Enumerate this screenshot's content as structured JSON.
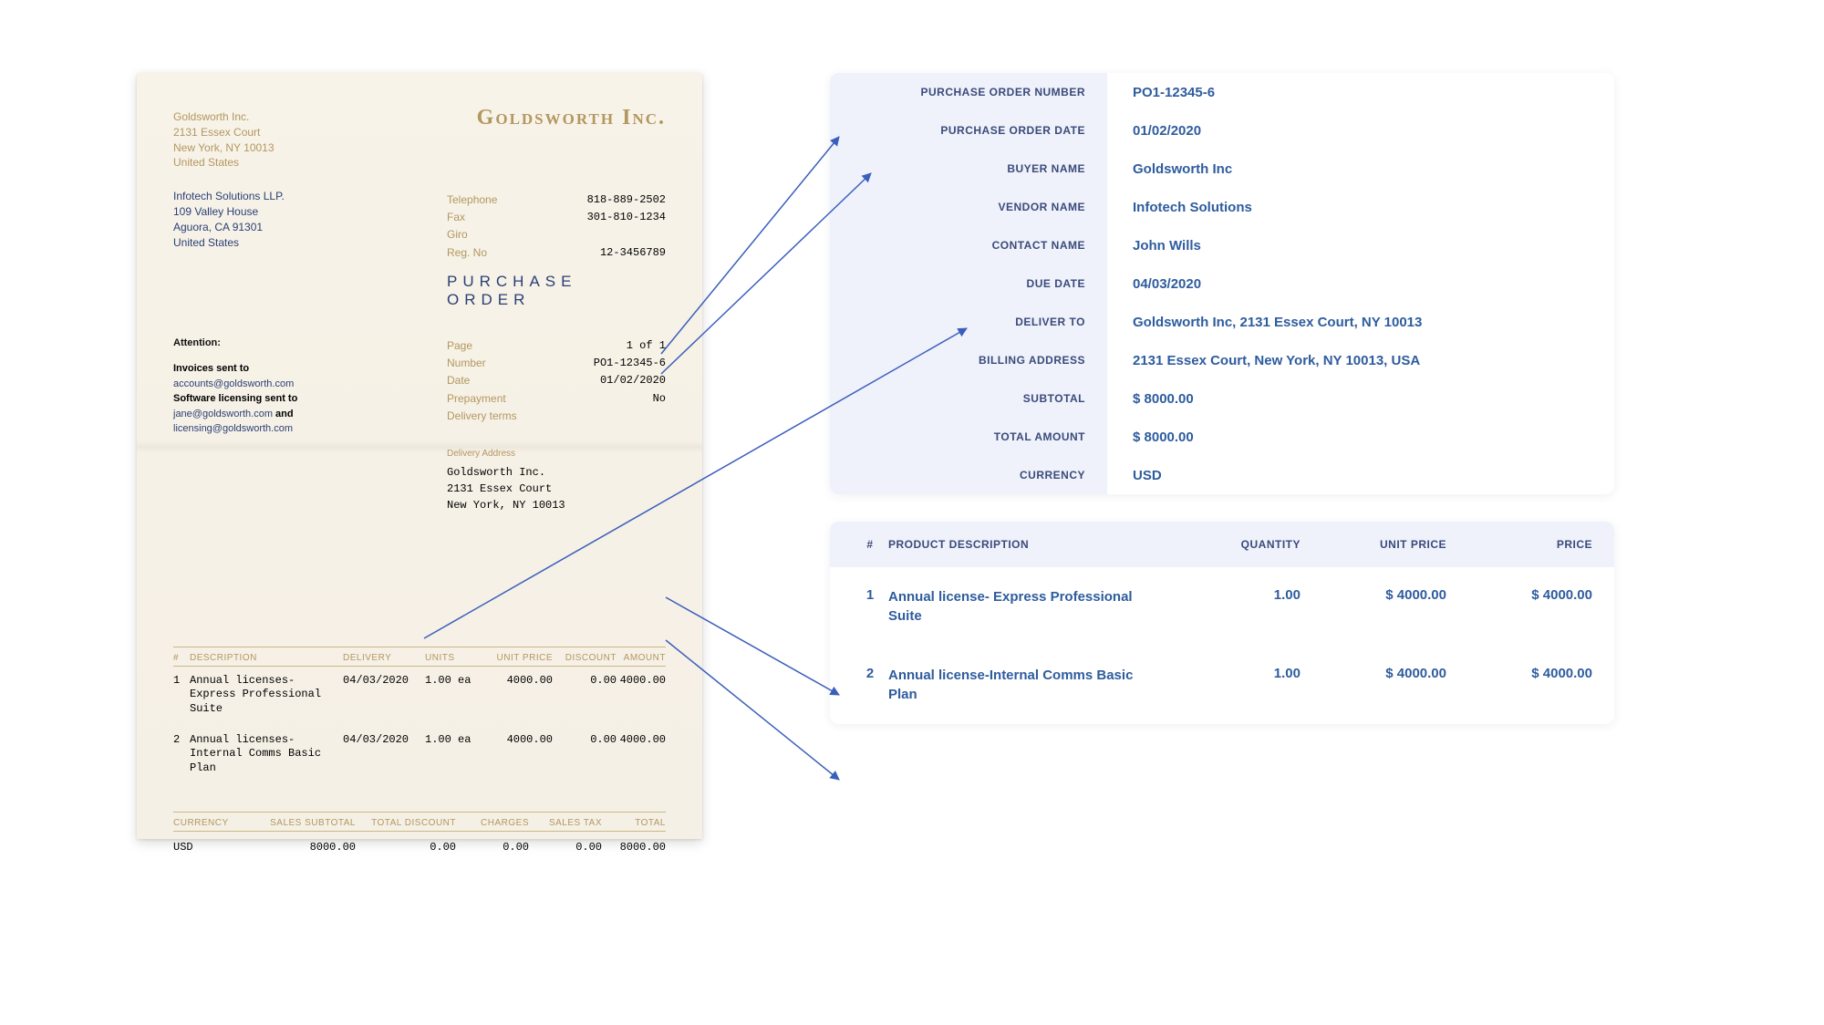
{
  "doc": {
    "brand": "Goldsworth Inc.",
    "from": {
      "name": "Goldsworth Inc.",
      "line1": "2131 Essex Court",
      "line2": "New York, NY 10013",
      "country": "United States"
    },
    "to": {
      "name": "Infotech Solutions LLP.",
      "line1": "109 Valley House",
      "line2": "Aguora, CA 91301",
      "country": "United States"
    },
    "contact": {
      "telephone_k": "Telephone",
      "telephone_v": "818-889-2502",
      "fax_k": "Fax",
      "fax_v": "301-810-1234",
      "giro_k": "Giro",
      "giro_v": "",
      "regno_k": "Reg. No",
      "regno_v": "12-3456789"
    },
    "po_title": "PURCHASE ORDER",
    "meta2": {
      "page_k": "Page",
      "page_v": "1 of 1",
      "number_k": "Number",
      "number_v": "PO1-12345-6",
      "date_k": "Date",
      "date_v": "01/02/2020",
      "prepay_k": "Prepayment",
      "prepay_v": "No",
      "terms_k": "Delivery terms",
      "terms_v": ""
    },
    "attention_hdr": "Attention:",
    "attn": {
      "l1a": "Invoices sent to ",
      "l1b": "accounts@goldsworth.com",
      "l2": "Software licensing sent to",
      "l3a": "jane@goldsworth.com",
      "l3b": " and",
      "l4": "licensing@goldsworth.com"
    },
    "delivery": {
      "hdr": "Delivery Address",
      "l1": "Goldsworth Inc.",
      "l2": "2131 Essex Court",
      "l3": "New York, NY 10013"
    },
    "items_hdr": {
      "num": "#",
      "desc": "DESCRIPTION",
      "deliv": "DELIVERY",
      "units": "UNITS",
      "up": "UNIT PRICE",
      "disc": "DISCOUNT",
      "amt": "AMOUNT"
    },
    "items": [
      {
        "num": "1",
        "desc": "Annual licenses- Express Professional Suite",
        "deliv": "04/03/2020",
        "units": "1.00 ea",
        "up": "4000.00",
        "disc": "0.00",
        "amt": "4000.00"
      },
      {
        "num": "2",
        "desc": "Annual licenses- Internal Comms Basic Plan",
        "deliv": "04/03/2020",
        "units": "1.00 ea",
        "up": "4000.00",
        "disc": "0.00",
        "amt": "4000.00"
      }
    ],
    "totals_hdr": {
      "cur": "CURRENCY",
      "sub": "SALES SUBTOTAL",
      "disc": "TOTAL DISCOUNT",
      "chg": "CHARGES",
      "tax": "SALES TAX",
      "tot": "TOTAL"
    },
    "totals": {
      "cur": "USD",
      "sub": "8000.00",
      "disc": "0.00",
      "chg": "0.00",
      "tax": "0.00",
      "tot": "8000.00"
    }
  },
  "extracted": {
    "rows": [
      {
        "k": "PURCHASE ORDER NUMBER",
        "v": "PO1-12345-6"
      },
      {
        "k": "PURCHASE ORDER DATE",
        "v": "01/02/2020"
      },
      {
        "k": "BUYER NAME",
        "v": "Goldsworth Inc"
      },
      {
        "k": "VENDOR NAME",
        "v": "Infotech Solutions"
      },
      {
        "k": "CONTACT NAME",
        "v": "John Wills"
      },
      {
        "k": "DUE DATE",
        "v": "04/03/2020"
      },
      {
        "k": "DELIVER TO",
        "v": "Goldsworth Inc, 2131 Essex Court, NY 10013"
      },
      {
        "k": "BILLING ADDRESS",
        "v": "2131 Essex Court, New York, NY 10013, USA"
      },
      {
        "k": "SUBTOTAL",
        "v": "$ 8000.00"
      },
      {
        "k": "TOTAL AMOUNT",
        "v": "$ 8000.00"
      },
      {
        "k": "CURRENCY",
        "v": "USD"
      }
    ],
    "table_hdr": {
      "num": "#",
      "desc": "PRODUCT DESCRIPTION",
      "qty": "QUANTITY",
      "up": "UNIT PRICE",
      "price": "PRICE"
    },
    "table": [
      {
        "num": "1",
        "desc": "Annual license- Express Professional Suite",
        "qty": "1.00",
        "up": "$ 4000.00",
        "price": "$ 4000.00"
      },
      {
        "num": "2",
        "desc": "Annual license-Internal Comms Basic Plan",
        "qty": "1.00",
        "up": "$ 4000.00",
        "price": "$ 4000.00"
      }
    ]
  }
}
